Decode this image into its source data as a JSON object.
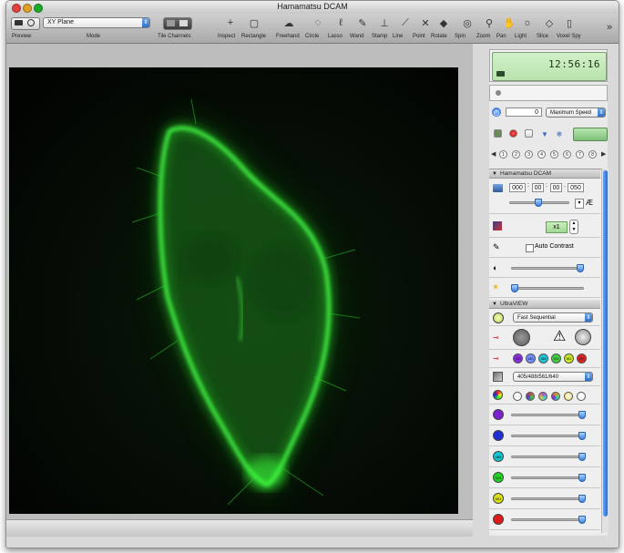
{
  "window": {
    "title": "Hamamatsu DCAM",
    "close_color": "#e0443e",
    "minimize_color": "#dea123",
    "zoom_color": "#1aab29"
  },
  "toolbar": {
    "preview_label": "Preview",
    "mode_label": "Mode",
    "mode_value": "XY Plane",
    "tile_channels_label": "Tile Channels",
    "tools": [
      {
        "label": "Inspect",
        "icon": "crosshair-icon",
        "glyph": "+"
      },
      {
        "label": "Rectangle",
        "icon": "rectangle-icon",
        "glyph": "▢"
      },
      {
        "label": "Freehand",
        "icon": "freehand-icon",
        "glyph": "☁"
      },
      {
        "label": "Circle",
        "icon": "circle-icon",
        "glyph": "◌"
      },
      {
        "label": "Lasso",
        "icon": "lasso-icon",
        "glyph": "ℓ"
      },
      {
        "label": "Wand",
        "icon": "wand-icon",
        "glyph": "✎"
      },
      {
        "label": "Stamp",
        "icon": "stamp-icon",
        "glyph": "⊥"
      },
      {
        "label": "Line",
        "icon": "line-icon",
        "glyph": "⟋"
      },
      {
        "label": "Point",
        "icon": "point-icon",
        "glyph": "✕"
      },
      {
        "label": "Rotate",
        "icon": "rotate-icon",
        "glyph": "◆"
      },
      {
        "label": "Spin",
        "icon": "spin-icon",
        "glyph": "◎"
      },
      {
        "label": "Zoom",
        "icon": "zoom-icon",
        "glyph": "⚲"
      },
      {
        "label": "Pan",
        "icon": "hand-icon",
        "glyph": "✋"
      },
      {
        "label": "Light",
        "icon": "light-icon",
        "glyph": "☼"
      },
      {
        "label": "Slice",
        "icon": "slice-icon",
        "glyph": "◇"
      },
      {
        "label": "Voxel Spy",
        "icon": "voxel-spy-icon",
        "glyph": "▯"
      }
    ],
    "overflow_glyph": "»"
  },
  "side_panel": {
    "clock": "12:56:16",
    "frame_count": "0",
    "speed_option": "Maximum Speed",
    "step_numbers": [
      "1",
      "2",
      "3",
      "4",
      "5",
      "6",
      "7",
      "8"
    ],
    "camera_section": {
      "title": "Hamamatsu DCAM",
      "exposure_fields": [
        "000",
        "00",
        "00",
        "050"
      ],
      "exposure_separators": [
        ":",
        ":",
        "."
      ],
      "auto_exposure_glyph": "Æ",
      "binning": "x1",
      "auto_contrast_label": "Auto Contrast",
      "contrast_level": 0.95,
      "brightness_level": 0.05
    },
    "ultraview_section": {
      "title": "UltraVIEW",
      "sequence_mode": "Fast Sequential",
      "laser_lines": "405/488/561/640",
      "laser_buttons": [
        {
          "label": "405",
          "color": "#8a2be2"
        },
        {
          "label": "440",
          "color": "#6f8cff"
        },
        {
          "label": "488",
          "color": "#19c7d9"
        },
        {
          "label": "514",
          "color": "#3ad13a"
        },
        {
          "label": "561",
          "color": "#c8e81e"
        },
        {
          "label": "640",
          "color": "#e02020"
        }
      ],
      "channel_sliders": [
        {
          "color": "#7b1fd1",
          "label": "",
          "level": 0.97
        },
        {
          "color": "#1f2fd6",
          "label": "",
          "level": 0.97
        },
        {
          "color": "#14c6cf",
          "label": "488",
          "level": 0.97
        },
        {
          "color": "#22d422",
          "label": "514",
          "level": 0.97
        },
        {
          "color": "#d8e01a",
          "label": "561",
          "level": 0.97
        },
        {
          "color": "#e01a1a",
          "label": "",
          "level": 0.97
        }
      ]
    }
  }
}
